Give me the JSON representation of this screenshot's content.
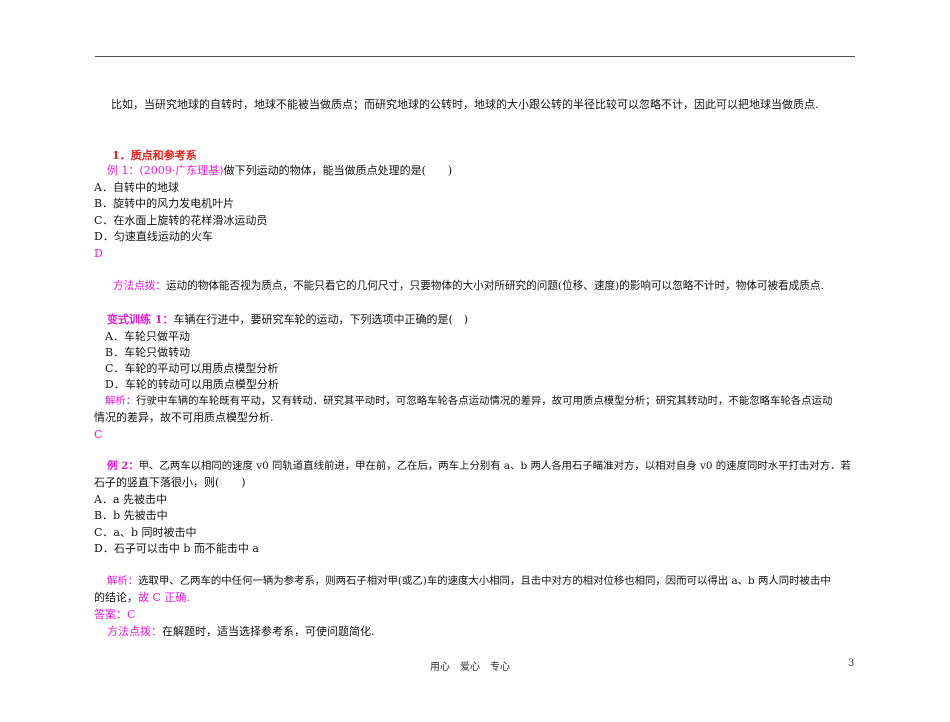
{
  "intro": "比如，当研究地球的自转时，地球不能被当做质点；而研究地球的公转时，地球的大小跟公转的半径比较可以忽略不计，因此可以把地球当做质点.",
  "section_heading": "1．质点和参考系",
  "ex1": {
    "label": "例 1：(2009·广东理基)",
    "question": "做下列运动的物体，能当做质点处理的是(　　)",
    "options": [
      "A．自转中的地球",
      "B．旋转中的风力发电机叶片",
      "C．在水面上旋转的花样滑冰运动员",
      "D．匀速直线运动的火车"
    ],
    "answer": "D",
    "method_label": "方法点拨：",
    "method": "运动的物体能否视为质点，不能只看它的几何尺寸，只要物体的大小对所研究的问题(位移、速度)的影响可以忽略不计时，物体可被看成质点."
  },
  "var1": {
    "label": "变式训练 1：",
    "question": "车辆在行进中，要研究车轮的运动，下列选项中正确的是(　)",
    "options": [
      "A．车轮只做平动",
      "B．车轮只做转动",
      "C．车轮的平动可以用质点模型分析",
      "D．车轮的转动可以用质点模型分析"
    ],
    "analysis_label": "解析：",
    "analysis_1": "行驶中车辆的车轮既有平动，又有转动．研究其平动时，可忽略车轮各点运动情况的差异，故可用质点模型分析；研究其转动时，不能忽略车轮各点运动",
    "analysis_2": "情况的差异，故不可用质点模型分析.",
    "answer": "C"
  },
  "ex2": {
    "label": "例 2：",
    "question_1": "甲、乙两车以相同的速度 v0 同轨道直线前进，甲在前，乙在后，两车上分别有 a、b 两人各用石子瞄准对方，以相对自身 v0 的速度同时水平打击对方．若",
    "question_2": "石子的竖直下落很小，则(　　)",
    "options": [
      "A．a 先被击中",
      "B．b 先被击中",
      "C．a、b 同时被击中",
      "D．石子可以击中 b 而不能击中 a"
    ],
    "analysis_label": "解析：",
    "analysis_1": "选取甲、乙两车的中任何一辆为参考系，则两石子相对甲(或乙)车的速度大小相同，且击中对方的相对位移也相同，因而可以得出 a、b 两人同时被击中",
    "analysis_2": "的结论，",
    "analysis_3": "故 C 正确.",
    "answer": "答案：C",
    "method_label": "方法点拨：",
    "method": "在解题时，适当选择参考系，可使问题简化."
  },
  "footer": "用心　爱心　专心",
  "page_number": "3"
}
